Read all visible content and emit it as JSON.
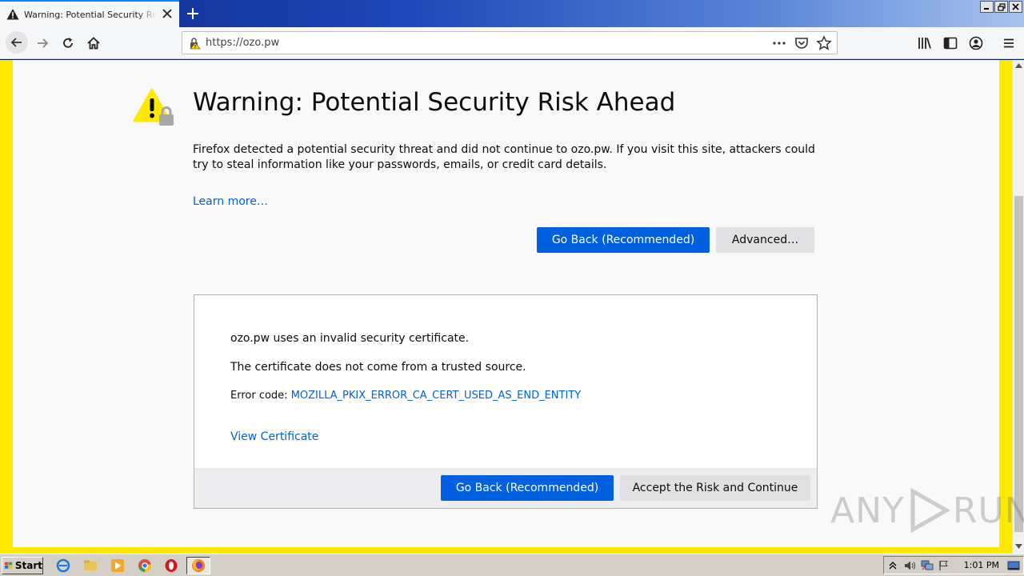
{
  "tab": {
    "title": "Warning: Potential Security Risk Ahead"
  },
  "urlbar": {
    "url": "https://ozo.pw"
  },
  "page": {
    "title": "Warning: Potential Security Risk Ahead",
    "intro": "Firefox detected a potential security threat and did not continue to ozo.pw. If you visit this site, attackers could try to steal information like your passwords, emails, or credit card details.",
    "learn_more": "Learn more…",
    "go_back": "Go Back (Recommended)",
    "advanced": "Advanced…"
  },
  "advanced_panel": {
    "line1": "ozo.pw uses an invalid security certificate.",
    "line2": "The certificate does not come from a trusted source.",
    "error_label": "Error code: ",
    "error_code": "MOZILLA_PKIX_ERROR_CA_CERT_USED_AS_END_ENTITY",
    "view_certificate": "View Certificate",
    "go_back": "Go Back (Recommended)",
    "accept": "Accept the Risk and Continue"
  },
  "watermark": {
    "left": "ANY",
    "right": "RUN"
  },
  "taskbar": {
    "start": "Start",
    "clock": "1:01 PM"
  },
  "colors": {
    "accent": "#0060df",
    "warning_border": "#ffe900",
    "warning_icon": "#ffe900"
  }
}
